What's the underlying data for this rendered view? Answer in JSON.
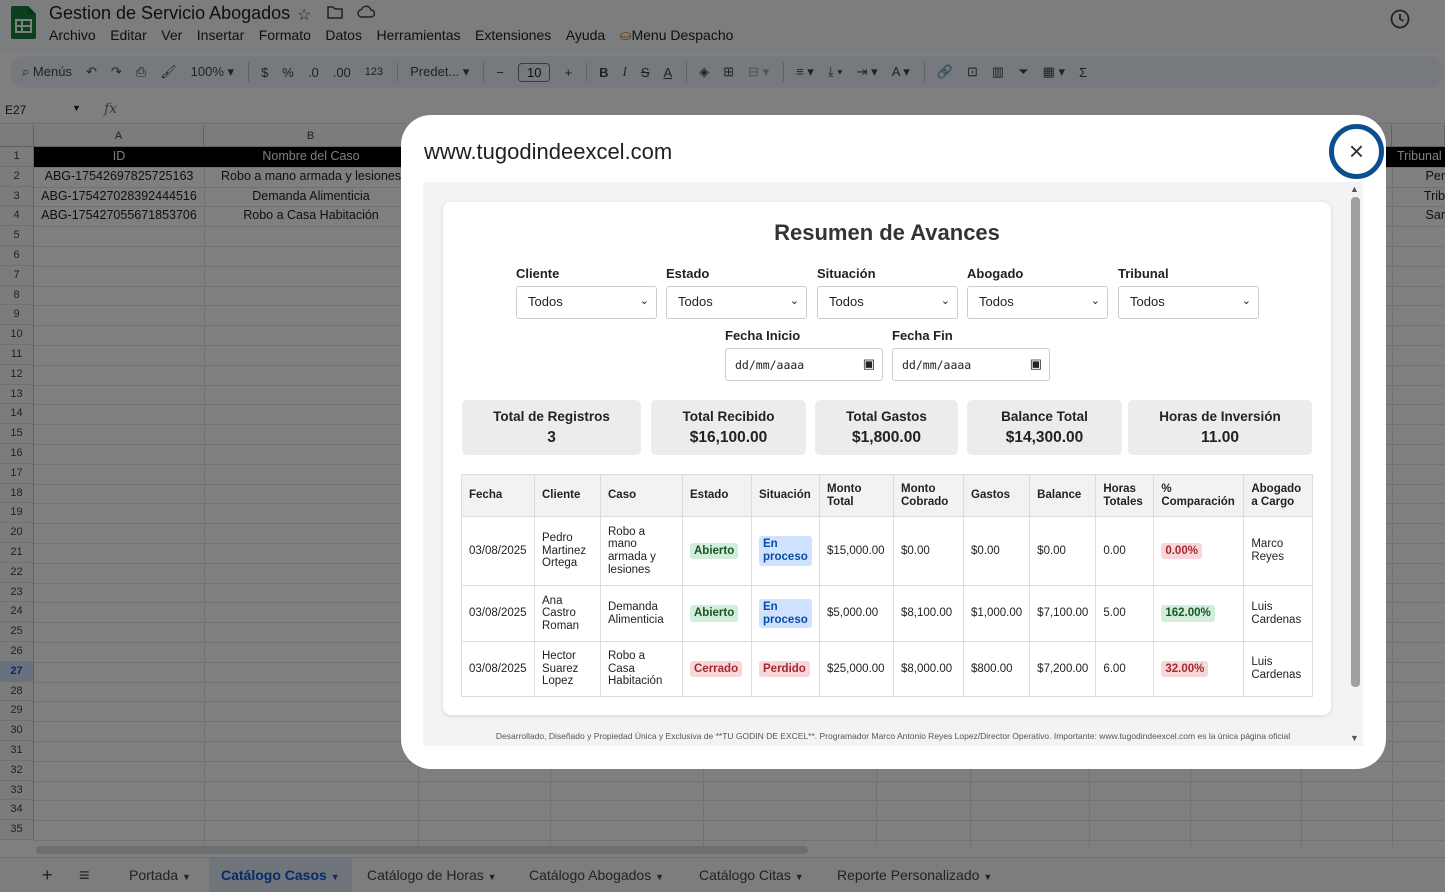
{
  "app": {
    "doc_title": "Gestion de Servicio Abogados",
    "menus": [
      "Archivo",
      "Editar",
      "Ver",
      "Insertar",
      "Formato",
      "Datos",
      "Herramientas",
      "Extensiones",
      "Ayuda",
      "Menu Despacho"
    ]
  },
  "toolbar": {
    "search_label": "Menús",
    "zoom": "100%",
    "currency": "$",
    "percent": "%",
    "dec_less": ".0",
    "dec_more": ".00",
    "number_format": "123",
    "font": "Predet...",
    "font_size": "10"
  },
  "formula_bar": {
    "name_box": "E27",
    "fx": "fx"
  },
  "sheet": {
    "columns": [
      "A",
      "B"
    ],
    "rows": [
      "1",
      "2",
      "3",
      "4",
      "5",
      "6",
      "7",
      "8",
      "9",
      "10",
      "11",
      "12",
      "13",
      "14",
      "15",
      "16",
      "17",
      "18",
      "19",
      "20",
      "21",
      "22",
      "23",
      "24",
      "25",
      "26",
      "27",
      "28",
      "29",
      "30",
      "31",
      "32",
      "33",
      "34",
      "35"
    ],
    "header_row": {
      "id": "ID",
      "nombre": "Nombre del Caso",
      "tribunal": "Tribunal"
    },
    "data_rows": [
      {
        "id": "ABG-17542697825725163",
        "nombre": "Robo a mano armada y lesiones",
        "tribunal": "Per"
      },
      {
        "id": "ABG-175427028392444516",
        "nombre": "Demanda Alimenticia",
        "tribunal": "Trib"
      },
      {
        "id": "ABG-175427055671853706",
        "nombre": "Robo a Casa Habitación",
        "tribunal": "Sar"
      }
    ]
  },
  "sheet_tabs": {
    "add": "+",
    "list": "≡",
    "tabs": [
      "Portada",
      "Catálogo Casos",
      "Catálogo de Horas",
      "Catálogo Abogados",
      "Catálogo Citas",
      "Reporte Personalizado"
    ]
  },
  "dialog": {
    "url": "www.tugodindeexcel.com",
    "close": "×",
    "report_title": "Resumen de Avances",
    "filters": [
      {
        "label": "Cliente",
        "value": "Todos"
      },
      {
        "label": "Estado",
        "value": "Todos"
      },
      {
        "label": "Situación",
        "value": "Todos"
      },
      {
        "label": "Abogado",
        "value": "Todos"
      },
      {
        "label": "Tribunal",
        "value": "Todos"
      }
    ],
    "date_filters": [
      {
        "label": "Fecha Inicio",
        "placeholder": "dd/mm/aaaa"
      },
      {
        "label": "Fecha Fin",
        "placeholder": "dd/mm/aaaa"
      }
    ],
    "stats": [
      {
        "label": "Total de Registros",
        "value": "3"
      },
      {
        "label": "Total Recibido",
        "value": "$16,100.00"
      },
      {
        "label": "Total Gastos",
        "value": "$1,800.00"
      },
      {
        "label": "Balance Total",
        "value": "$14,300.00"
      },
      {
        "label": "Horas de Inversión",
        "value": "11.00"
      }
    ],
    "table_headers": [
      "Fecha",
      "Cliente",
      "Caso",
      "Estado",
      "Situación",
      "Monto Total",
      "Monto Cobrado",
      "Gastos",
      "Balance",
      "Horas Totales",
      "% Comparación",
      "Abogado a Cargo"
    ],
    "rows": [
      {
        "fecha": "03/08/2025",
        "cliente": "Pedro Martinez Ortega",
        "caso": "Robo a mano armada y lesiones",
        "estado": "Abierto",
        "situacion": "En proceso",
        "monto_total": "$15,000.00",
        "monto_cobrado": "$0.00",
        "gastos": "$0.00",
        "balance": "$0.00",
        "horas": "0.00",
        "comparacion": "0.00%",
        "abogado": "Marco Reyes"
      },
      {
        "fecha": "03/08/2025",
        "cliente": "Ana Castro Roman",
        "caso": "Demanda Alimenticia",
        "estado": "Abierto",
        "situacion": "En proceso",
        "monto_total": "$5,000.00",
        "monto_cobrado": "$8,100.00",
        "gastos": "$1,000.00",
        "balance": "$7,100.00",
        "horas": "5.00",
        "comparacion": "162.00%",
        "abogado": "Luis Cardenas"
      },
      {
        "fecha": "03/08/2025",
        "cliente": "Hector Suarez Lopez",
        "caso": "Robo a Casa Habitación",
        "estado": "Cerrado",
        "situacion": "Perdido",
        "monto_total": "$25,000.00",
        "monto_cobrado": "$8,000.00",
        "gastos": "$800.00",
        "balance": "$7,200.00",
        "horas": "6.00",
        "comparacion": "32.00%",
        "abogado": "Luis Cardenas"
      }
    ],
    "footer": "Desarrollado, Diseñado y Propiedad Única y Exclusiva de **TU GODIN DE EXCEL**. Programador Marco Antonio Reyes Lopez/Director Operativo. Importante: www.tugodindeexcel.com es la única página oficial"
  },
  "colors": {
    "accent": "#0b57d0",
    "header_black": "#000000",
    "close_ring": "#0b4f8f",
    "sheets_green": "#188038"
  }
}
